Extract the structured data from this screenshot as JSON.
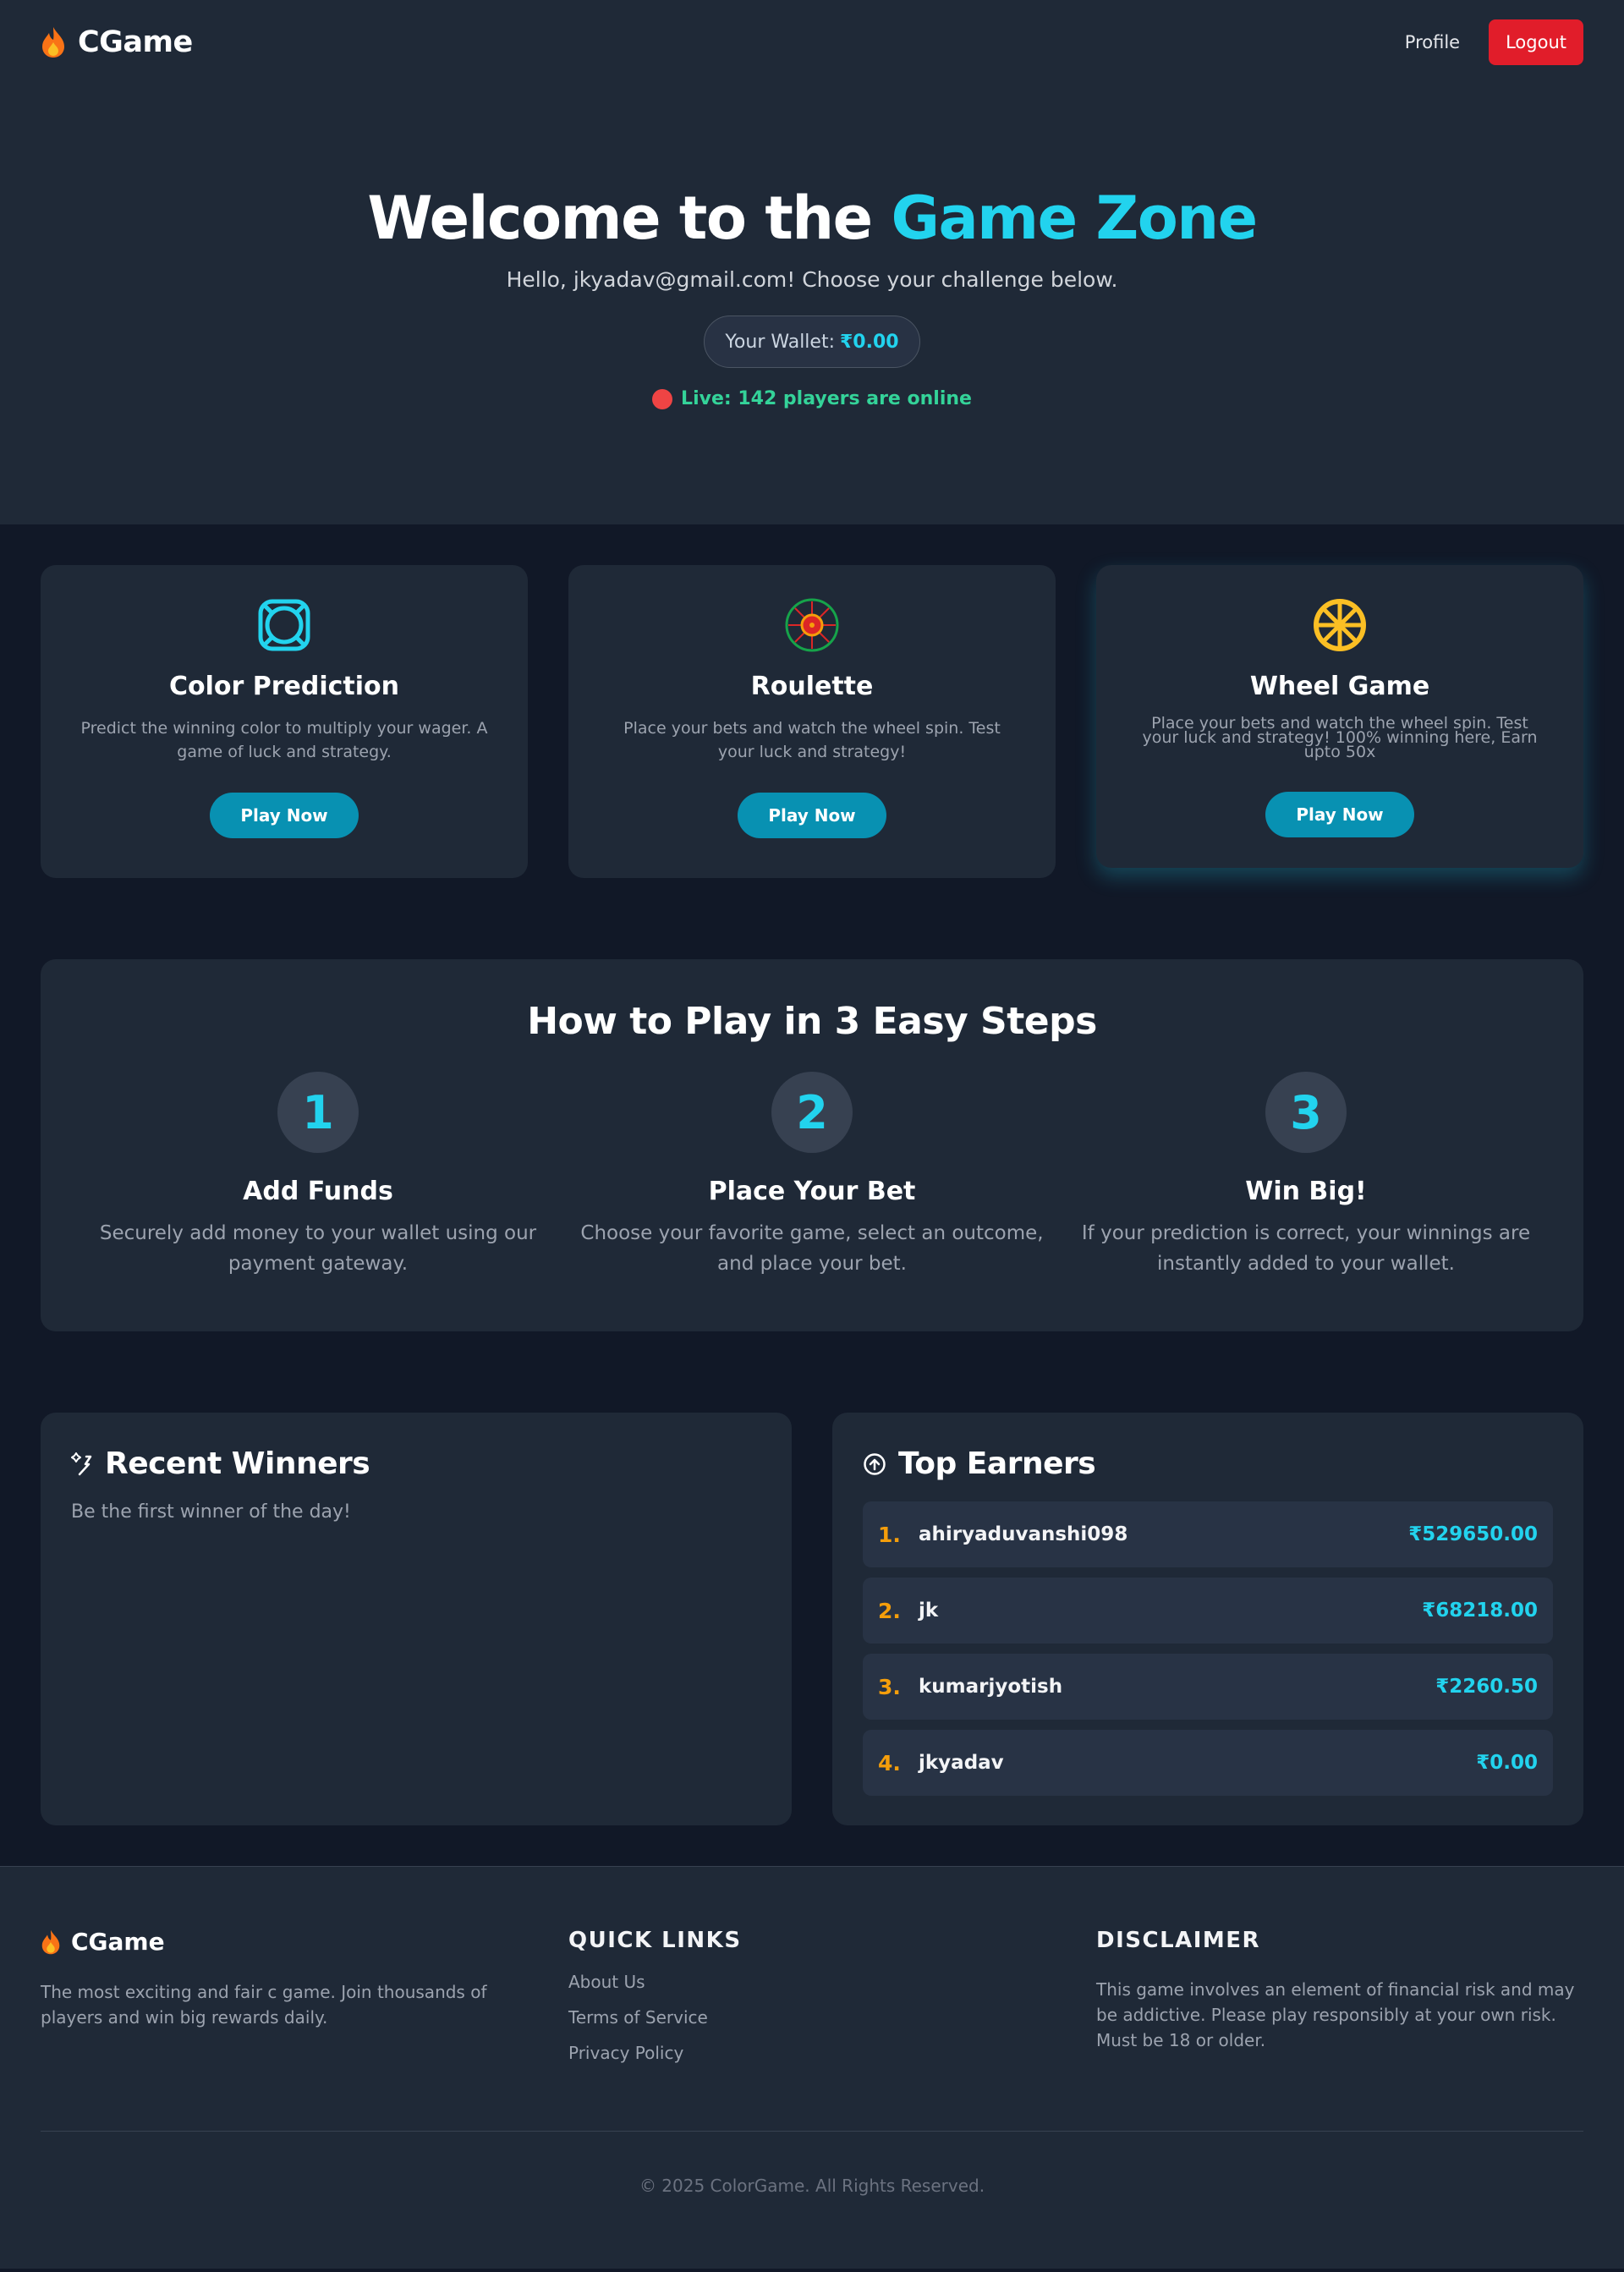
{
  "nav": {
    "brand": "CGame",
    "profile_label": "Profile",
    "logout_label": "Logout"
  },
  "hero": {
    "title_prefix": "Welcome to the ",
    "title_accent": "Game Zone",
    "greeting": "Hello, jkyadav@gmail.com! Choose your challenge below.",
    "wallet_label": "Your Wallet:",
    "wallet_amount": "₹0.00",
    "live_text": "Live: 142 players are online"
  },
  "games": [
    {
      "title": "Color Prediction",
      "desc": "Predict the winning color to multiply your wager. A game of luck and strategy.",
      "button": "Play Now"
    },
    {
      "title": "Roulette",
      "desc": "Place your bets and watch the wheel spin. Test your luck and strategy!",
      "button": "Play Now"
    },
    {
      "title": "Wheel Game",
      "desc": "Place your bets and watch the wheel spin. Test your luck and strategy! 100% winning here, Earn upto 50x",
      "button": "Play Now"
    }
  ],
  "steps": {
    "title": "How to Play in 3 Easy Steps",
    "items": [
      {
        "num": "1",
        "title": "Add Funds",
        "desc": "Securely add money to your wallet using our payment gateway."
      },
      {
        "num": "2",
        "title": "Place Your Bet",
        "desc": "Choose your favorite game, select an outcome, and place your bet."
      },
      {
        "num": "3",
        "title": "Win Big!",
        "desc": "If your prediction is correct, your winnings are instantly added to your wallet."
      }
    ]
  },
  "recent_winners": {
    "title": "Recent Winners",
    "empty_text": "Be the first winner of the day!"
  },
  "top_earners": {
    "title": "Top Earners",
    "rows": [
      {
        "rank": "1.",
        "name": "ahiryaduvanshi098",
        "amount": "₹529650.00"
      },
      {
        "rank": "2.",
        "name": "jk",
        "amount": "₹68218.00"
      },
      {
        "rank": "3.",
        "name": "kumarjyotish",
        "amount": "₹2260.50"
      },
      {
        "rank": "4.",
        "name": "jkyadav",
        "amount": "₹0.00"
      }
    ]
  },
  "footer": {
    "brand": "CGame",
    "about": "The most exciting and fair c game. Join thousands of players and win big rewards daily.",
    "quick_links_title": "QUICK LINKS",
    "links": [
      "About Us",
      "Terms of Service",
      "Privacy Policy"
    ],
    "disclaimer_title": "DISCLAIMER",
    "disclaimer": "This game involves an element of financial risk and may be addictive. Please play responsibly at your own risk. Must be 18 or older.",
    "copyright": "© 2025 ColorGame. All Rights Reserved."
  },
  "colors": {
    "accent": "#22d3ee",
    "logout": "#e11d2a",
    "play_button": "#0891b2",
    "live_text": "#34d399",
    "rank": "#f59e0b"
  },
  "icons": {
    "brand": "flame-icon",
    "color_prediction": "life-ring-icon",
    "roulette": "roulette-wheel-icon",
    "wheel_game": "wheel-icon",
    "recent_winners": "sparkle-wand-icon",
    "top_earners": "arrow-up-circle-icon"
  }
}
